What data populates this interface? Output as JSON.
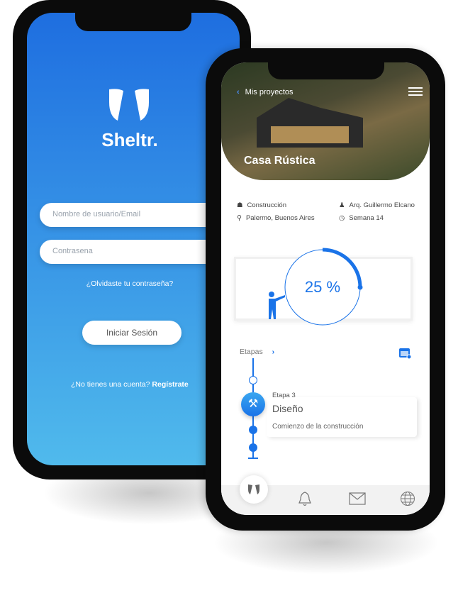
{
  "login": {
    "brand": "Sheltr.",
    "username_placeholder": "Nombre de usuario/Email",
    "password_placeholder": "Contrasena",
    "forgot": "¿Olvidaste tu contraseña?",
    "login_button": "Iniciar Sesión",
    "no_account": "¿No tienes una cuenta?",
    "register": "Regístrate"
  },
  "project": {
    "back_label": "Mis proyectos",
    "title": "Casa Rústica",
    "type": "Construcción",
    "location": "Palermo, Buenos Aires",
    "architect": "Arq. Guillermo Elcano",
    "week": "Semana 14",
    "progress_label": "25 %",
    "progress": 25,
    "stages_label": "Etapas",
    "stage_number": "Etapa 3",
    "stage_name": "Diseño",
    "stage_desc": "Comienzo de la construcción"
  },
  "colors": {
    "accent": "#1a73e8",
    "grad_top": "#1e6ee0",
    "grad_bottom": "#50baec"
  }
}
